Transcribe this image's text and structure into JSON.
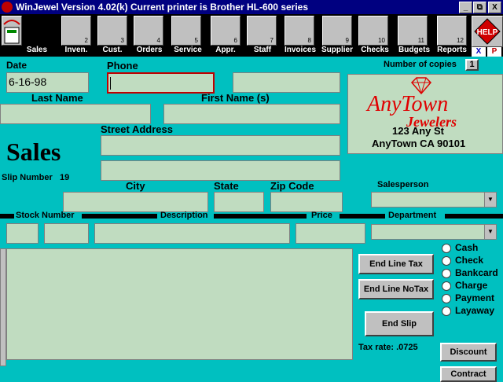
{
  "window": {
    "title": "WinJewel Version 4.02(k)   Current printer is Brother HL-600 series",
    "min_label": "_",
    "max_label": "⧉",
    "close_label": "X"
  },
  "toolbar": {
    "items": [
      {
        "label": "Sales",
        "num": "",
        "icon": "calculator-icon"
      },
      {
        "label": "Inven.",
        "num": "2",
        "icon": "ring-icon"
      },
      {
        "label": "Cust.",
        "num": "3",
        "icon": "handshake-icon"
      },
      {
        "label": "Orders",
        "num": "4",
        "icon": "order-book-icon"
      },
      {
        "label": "Service",
        "num": "5",
        "icon": "workbench-icon"
      },
      {
        "label": "Appr.",
        "num": "6",
        "icon": "microscope-icon"
      },
      {
        "label": "Staff",
        "num": "7",
        "icon": "staff-icon"
      },
      {
        "label": "Invoices",
        "num": "8",
        "icon": "invoice-icon"
      },
      {
        "label": "Supplier",
        "num": "9",
        "icon": "books-icon"
      },
      {
        "label": "Checks",
        "num": "10",
        "icon": "checkbook-icon"
      },
      {
        "label": "Budgets",
        "num": "11",
        "icon": "money-bag-icon"
      },
      {
        "label": "Reports",
        "num": "12",
        "icon": "utilities-icon"
      }
    ],
    "help_label": "HELP",
    "x_label": "X",
    "p_label": "P"
  },
  "form": {
    "date_label": "Date",
    "date_value": "6-16-98",
    "phone_label": "Phone",
    "phone_value": "",
    "last_name_label": "Last Name",
    "first_name_label": "First Name (s)",
    "street_label": "Street Address",
    "city_label": "City",
    "state_label": "State",
    "zip_label": "Zip Code",
    "salesperson_label": "Salesperson",
    "copies_label": "Number of copies",
    "copies_value": "1",
    "heading": "Sales",
    "slip_label": "Slip Number",
    "slip_number": "19"
  },
  "store": {
    "name_line1": "AnyTown",
    "name_line2": "Jewelers",
    "address1": "123 Any St",
    "address2": "AnyTown CA 90101"
  },
  "line_items": {
    "stock_label": "Stock Number",
    "description_label": "Description",
    "price_label": "Price",
    "department_label": "Department"
  },
  "buttons": {
    "end_line_tax": "End Line Tax",
    "end_line_notax": "End Line NoTax",
    "end_slip": "End Slip",
    "discount": "Discount",
    "contract": "Contract"
  },
  "payment": {
    "options": [
      "Cash",
      "Check",
      "Bankcard",
      "Charge",
      "Payment",
      "Layaway"
    ]
  },
  "tax_rate_text": "Tax rate: .0725",
  "colors": {
    "background": "#00c0c0",
    "field": "#c0dcc0",
    "titlebar": "#000080",
    "brand_red": "#e00000"
  }
}
